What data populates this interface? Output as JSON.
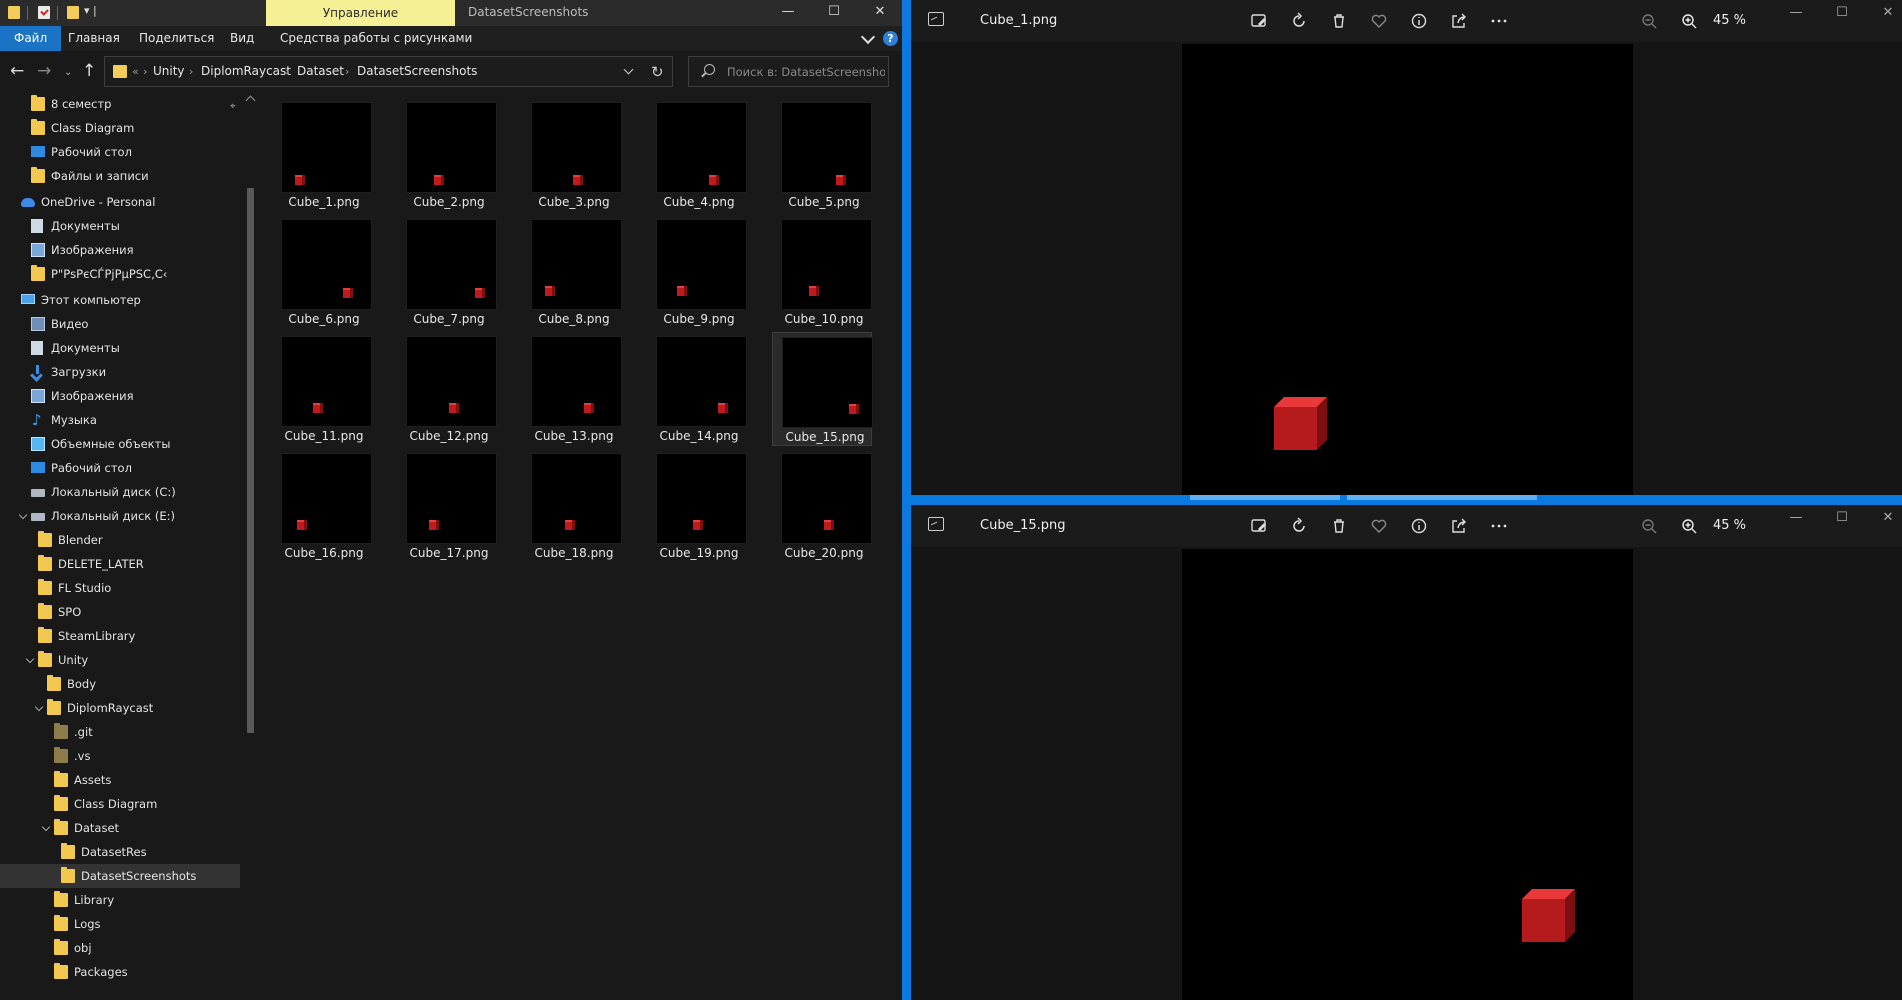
{
  "explorer": {
    "contextual_tab": "Управление",
    "window_title": "DatasetScreenshots",
    "quick_access_dropdown": "▾ |",
    "window_controls": {
      "minimize": "—",
      "maximize": "☐",
      "close": "✕"
    },
    "ribbon_tabs": [
      "Файл",
      "Главная",
      "Поделиться",
      "Вид",
      "Средства работы с рисунками"
    ],
    "help": "?",
    "nav": {
      "back": "←",
      "forward": "→",
      "recent": "⌄",
      "up": "↑",
      "refresh": "↻"
    },
    "address": {
      "overflow": "«",
      "crumbs": [
        "Unity",
        "DiplomRaycast",
        "Dataset",
        "DatasetScreenshots"
      ],
      "separator": "›"
    },
    "search": {
      "placeholder": "Поиск в: DatasetScreenshots"
    },
    "tree": [
      {
        "label": "8 семестр",
        "icon": "folder-icon",
        "indent": 0,
        "pin": true
      },
      {
        "label": "Class Diagram",
        "icon": "folder-icon",
        "indent": 0
      },
      {
        "label": "Рабочий стол",
        "icon": "desktop-icon",
        "indent": 0
      },
      {
        "label": "Файлы и записи",
        "icon": "folder-icon",
        "indent": 0
      },
      {
        "label": "OneDrive - Personal",
        "icon": "cloud-icon",
        "indent": -1,
        "gap": true
      },
      {
        "label": "Документы",
        "icon": "documents-icon",
        "indent": 0
      },
      {
        "label": "Изображения",
        "icon": "pictures-icon",
        "indent": 0
      },
      {
        "label": "Р\"РѕРєСЃРјРµРЅС‚С‹",
        "icon": "folder-icon",
        "indent": 0
      },
      {
        "label": "Этот компьютер",
        "icon": "computer-icon",
        "indent": -1,
        "gap": true
      },
      {
        "label": "Видео",
        "icon": "video-icon",
        "indent": 0
      },
      {
        "label": "Документы",
        "icon": "documents-icon",
        "indent": 0
      },
      {
        "label": "Загрузки",
        "icon": "downloads-icon",
        "indent": 0
      },
      {
        "label": "Изображения",
        "icon": "pictures-icon",
        "indent": 0
      },
      {
        "label": "Музыка",
        "icon": "music-icon",
        "indent": 0
      },
      {
        "label": "Объемные объекты",
        "icon": "3d-objects-icon",
        "indent": 0
      },
      {
        "label": "Рабочий стол",
        "icon": "desktop-icon",
        "indent": 0
      },
      {
        "label": "Локальный диск (C:)",
        "icon": "drive-icon",
        "indent": 0
      },
      {
        "label": "Локальный диск (E:)",
        "icon": "drive-icon",
        "indent": 0,
        "expanded": true
      },
      {
        "label": "Blender",
        "icon": "folder-icon",
        "indent": 1
      },
      {
        "label": "DELETE_LATER",
        "icon": "folder-icon",
        "indent": 1
      },
      {
        "label": "FL Studio",
        "icon": "folder-icon",
        "indent": 1
      },
      {
        "label": "SPO",
        "icon": "folder-icon",
        "indent": 1
      },
      {
        "label": "SteamLibrary",
        "icon": "folder-icon",
        "indent": 1
      },
      {
        "label": "Unity",
        "icon": "folder-icon",
        "indent": 1,
        "expanded": true
      },
      {
        "label": "Body",
        "icon": "folder-icon",
        "indent": 2
      },
      {
        "label": "DiplomRaycast",
        "icon": "folder-icon",
        "indent": 2,
        "expanded": true
      },
      {
        "label": ".git",
        "icon": "folder-icon-hidden",
        "indent": 3
      },
      {
        "label": ".vs",
        "icon": "folder-icon-hidden",
        "indent": 3
      },
      {
        "label": "Assets",
        "icon": "folder-icon",
        "indent": 3
      },
      {
        "label": "Class Diagram",
        "icon": "folder-icon",
        "indent": 3
      },
      {
        "label": "Dataset",
        "icon": "folder-icon",
        "indent": 3,
        "expanded": true
      },
      {
        "label": "DatasetRes",
        "icon": "folder-icon",
        "indent": 4
      },
      {
        "label": "DatasetScreenshots",
        "icon": "folder-icon",
        "indent": 4,
        "selected": true
      },
      {
        "label": "Library",
        "icon": "folder-icon",
        "indent": 3
      },
      {
        "label": "Logs",
        "icon": "folder-icon",
        "indent": 3
      },
      {
        "label": "obj",
        "icon": "folder-icon",
        "indent": 3
      },
      {
        "label": "Packages",
        "icon": "folder-icon",
        "indent": 3
      }
    ],
    "files": [
      {
        "name": "Cube_1.png",
        "cube": [
          0.2,
          0.85
        ]
      },
      {
        "name": "Cube_2.png",
        "cube": [
          0.35,
          0.85
        ]
      },
      {
        "name": "Cube_3.png",
        "cube": [
          0.5,
          0.85
        ]
      },
      {
        "name": "Cube_4.png",
        "cube": [
          0.63,
          0.85
        ]
      },
      {
        "name": "Cube_5.png",
        "cube": [
          0.65,
          0.85
        ]
      },
      {
        "name": "Cube_6.png",
        "cube": [
          0.72,
          0.8
        ]
      },
      {
        "name": "Cube_7.png",
        "cube": [
          0.8,
          0.8
        ]
      },
      {
        "name": "Cube_8.png",
        "cube": [
          0.2,
          0.78
        ]
      },
      {
        "name": "Cube_9.png",
        "cube": [
          0.27,
          0.78
        ]
      },
      {
        "name": "Cube_10.png",
        "cube": [
          0.35,
          0.78
        ]
      },
      {
        "name": "Cube_11.png",
        "cube": [
          0.4,
          0.78
        ]
      },
      {
        "name": "Cube_12.png",
        "cube": [
          0.52,
          0.78
        ]
      },
      {
        "name": "Cube_13.png",
        "cube": [
          0.63,
          0.78
        ]
      },
      {
        "name": "Cube_14.png",
        "cube": [
          0.72,
          0.78
        ]
      },
      {
        "name": "Cube_15.png",
        "cube": [
          0.78,
          0.78
        ],
        "selected": true
      },
      {
        "name": "Cube_16.png",
        "cube": [
          0.22,
          0.78
        ]
      },
      {
        "name": "Cube_17.png",
        "cube": [
          0.3,
          0.78
        ]
      },
      {
        "name": "Cube_18.png",
        "cube": [
          0.42,
          0.78
        ]
      },
      {
        "name": "Cube_19.png",
        "cube": [
          0.45,
          0.78
        ]
      },
      {
        "name": "Cube_20.png",
        "cube": [
          0.52,
          0.78
        ]
      }
    ]
  },
  "photos": [
    {
      "filename": "Cube_1.png",
      "zoom": "45 %",
      "icons": [
        "edit-image-icon",
        "rotate-icon",
        "delete-icon",
        "favorite-icon",
        "info-icon",
        "share-icon",
        "more-icon",
        "zoom-out-icon",
        "zoom-in-icon"
      ],
      "window_controls": {
        "minimize": "—",
        "maximize": "☐",
        "close": "✕"
      },
      "cube": [
        0.26,
        0.84
      ]
    },
    {
      "filename": "Cube_15.png",
      "zoom": "45 %",
      "icons": [
        "edit-image-icon",
        "rotate-icon",
        "delete-icon",
        "favorite-icon",
        "info-icon",
        "share-icon",
        "more-icon",
        "zoom-out-icon",
        "zoom-in-icon"
      ],
      "window_controls": {
        "minimize": "—",
        "maximize": "☐",
        "close": "✕"
      },
      "cube": [
        0.81,
        0.81
      ]
    }
  ],
  "colors": {
    "accent": "#0b7ae0",
    "contextual_tab": "#f5f094",
    "file_tab": "#1a73c4",
    "folder": "#f2c850",
    "cube": "#c11a1a"
  }
}
